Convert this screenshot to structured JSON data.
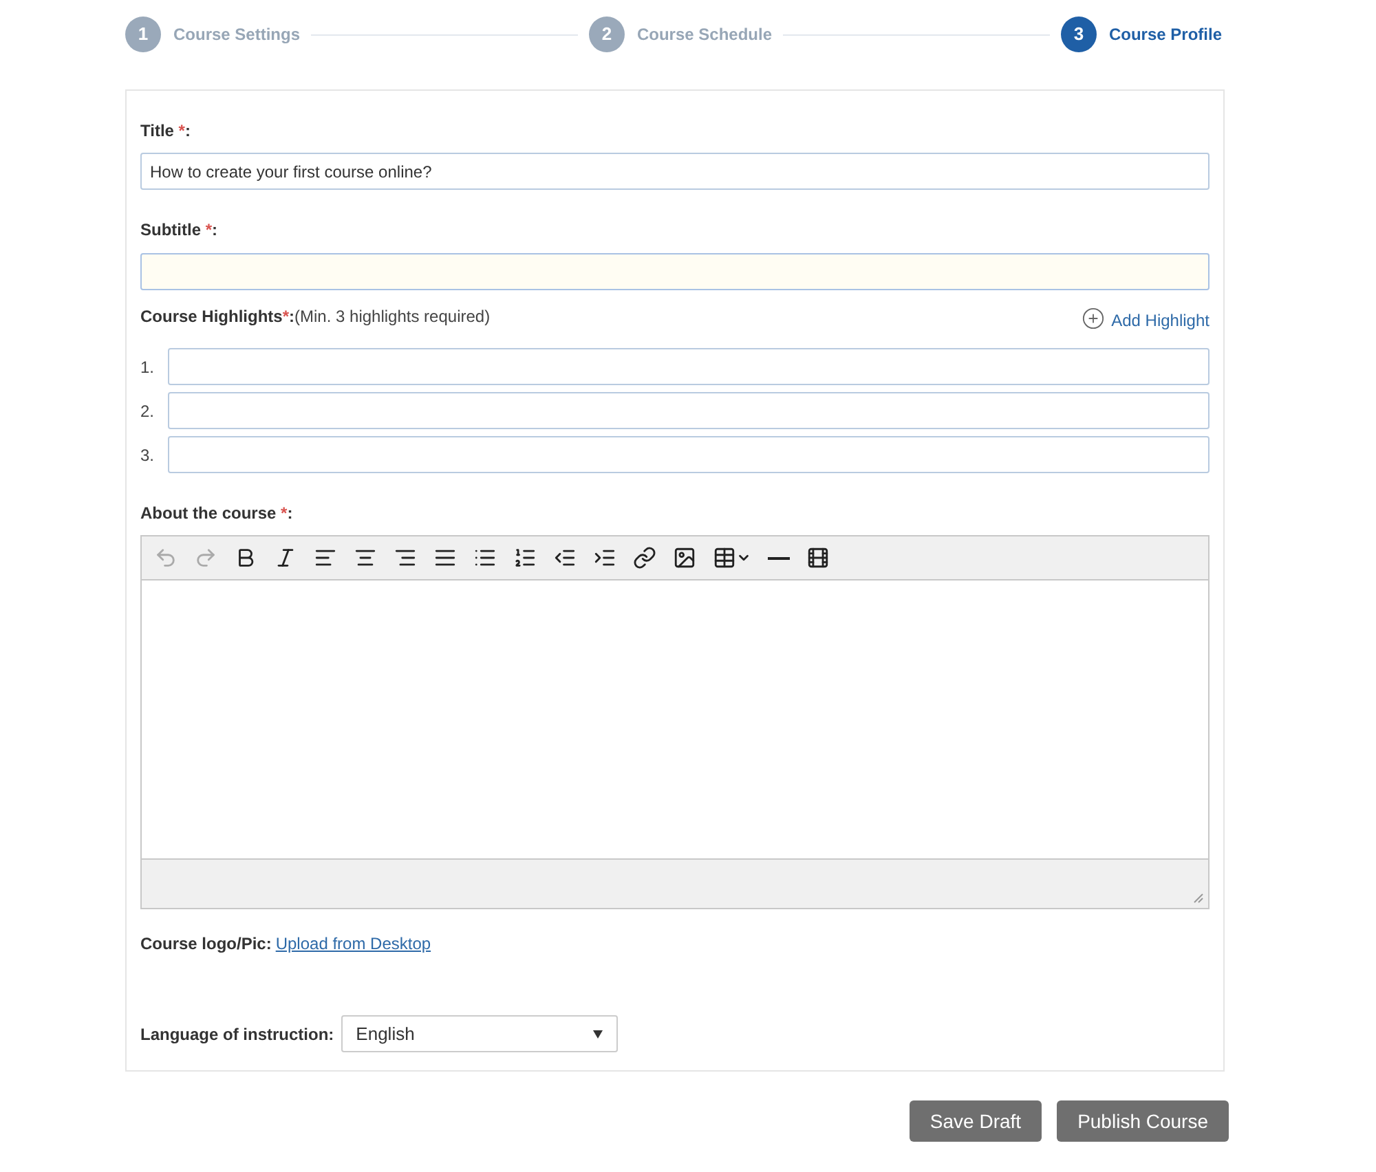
{
  "steps": [
    {
      "number": "1",
      "label": "Course Settings",
      "selected": false
    },
    {
      "number": "2",
      "label": "Course Schedule",
      "selected": false
    },
    {
      "number": "3",
      "label": "Course Profile",
      "selected": true
    }
  ],
  "title_field": {
    "label": "Title",
    "required_mark": "*",
    "suffix": ":",
    "value": "How to create your first course online?"
  },
  "subtitle_field": {
    "label": "Subtitle",
    "required_mark": "*",
    "suffix": ":"
  },
  "highlights": {
    "label": "Course Highlights",
    "required_mark": "*",
    "suffix": ":",
    "note": "(Min. 3 highlights required)",
    "add_link": "Add Highlight",
    "items": [
      {
        "number": "1."
      },
      {
        "number": "2."
      },
      {
        "number": "3."
      }
    ]
  },
  "about": {
    "label": "About the course",
    "required_mark": "*",
    "suffix": ":",
    "toolbar": [
      {
        "kind": "undo",
        "disabled": true
      },
      {
        "kind": "redo",
        "disabled": true
      },
      {
        "kind": "bold",
        "disabled": false
      },
      {
        "kind": "italic",
        "disabled": false
      },
      {
        "kind": "align-left",
        "disabled": false
      },
      {
        "kind": "align-center",
        "disabled": false
      },
      {
        "kind": "align-right",
        "disabled": false
      },
      {
        "kind": "justify",
        "disabled": false
      },
      {
        "kind": "bullets",
        "disabled": false
      },
      {
        "kind": "numbers",
        "disabled": false
      },
      {
        "kind": "outdent",
        "disabled": false
      },
      {
        "kind": "indent",
        "disabled": false
      },
      {
        "kind": "link",
        "disabled": false
      },
      {
        "kind": "image",
        "disabled": false
      },
      {
        "kind": "table",
        "disabled": false
      },
      {
        "kind": "rule",
        "disabled": false
      },
      {
        "kind": "media",
        "disabled": false
      }
    ]
  },
  "logo": {
    "label": "Course logo/Pic:",
    "link": "Upload from Desktop"
  },
  "language": {
    "label": "Language of instruction:",
    "value": "English"
  },
  "buttons": [
    "Save Draft",
    "Publish Course"
  ]
}
